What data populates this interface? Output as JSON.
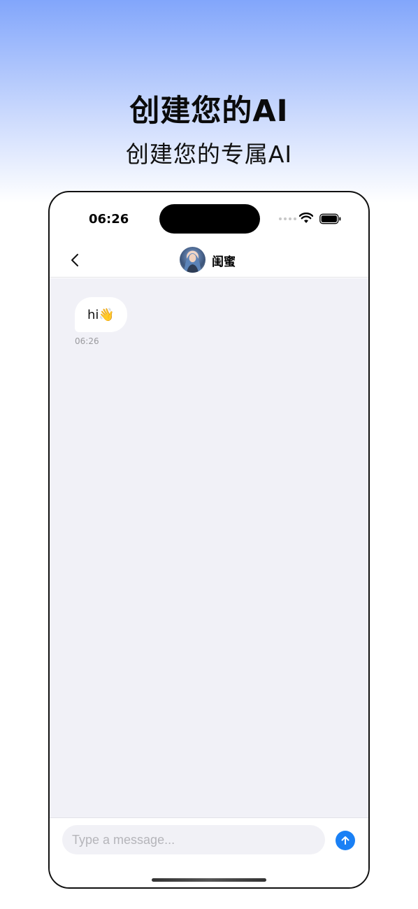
{
  "hero": {
    "title": "创建您的AI",
    "subtitle": "创建您的专属AI"
  },
  "status_bar": {
    "time": "06:26"
  },
  "nav": {
    "title": "闺蜜",
    "back_icon": "chevron-left-icon"
  },
  "messages": [
    {
      "text": "hi👋",
      "time": "06:26",
      "sender": "ai"
    }
  ],
  "composer": {
    "placeholder": "Type a message...",
    "send_icon": "arrow-up-icon"
  },
  "colors": {
    "accent": "#1a80f5",
    "chat_background": "#f1f1f7",
    "gradient_top": "#82a6fb"
  }
}
